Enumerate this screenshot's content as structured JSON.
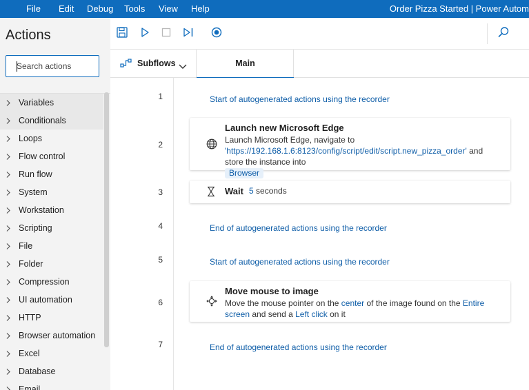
{
  "menu": {
    "items": [
      "File",
      "Edit",
      "Debug",
      "Tools",
      "View",
      "Help"
    ],
    "window_title": "Order Pizza Started | Power Autom"
  },
  "actions_pane": {
    "title": "Actions",
    "search_placeholder": "Search actions",
    "categories": [
      "Variables",
      "Conditionals",
      "Loops",
      "Flow control",
      "Run flow",
      "System",
      "Workstation",
      "Scripting",
      "File",
      "Folder",
      "Compression",
      "UI automation",
      "HTTP",
      "Browser automation",
      "Excel",
      "Database",
      "Email"
    ]
  },
  "toolbar": {
    "icons": [
      "save-icon",
      "run-icon",
      "stop-icon",
      "run-next-action-icon",
      "record-icon",
      "search-icon"
    ]
  },
  "tabs": {
    "subflows_label": "Subflows",
    "main_label": "Main"
  },
  "flow": {
    "steps": [
      {
        "num": "1",
        "type": "comment",
        "text": "Start of autogenerated actions using the recorder"
      },
      {
        "num": "2",
        "type": "action",
        "icon": "globe-icon",
        "title": "Launch new Microsoft Edge",
        "desc_prefix": "Launch Microsoft Edge, navigate to ",
        "url": "'https://192.168.1.6:8123/config/script/edit/script.new_pizza_order'",
        "desc_suffix": " and store the instance into",
        "variable": "Browser"
      },
      {
        "num": "3",
        "type": "action",
        "icon": "hourglass-icon",
        "title": "Wait",
        "value": "5",
        "unit": " seconds"
      },
      {
        "num": "4",
        "type": "comment",
        "text": "End of autogenerated actions using the recorder"
      },
      {
        "num": "5",
        "type": "comment",
        "text": "Start of autogenerated actions using the recorder"
      },
      {
        "num": "6",
        "type": "action",
        "icon": "move-mouse-icon",
        "title": "Move mouse to image",
        "p1": "Move the mouse pointer on the ",
        "k1": "center",
        "p2": " of the image found on the ",
        "k2": "Entire screen",
        "p3": " and send a ",
        "k3": "Left click",
        "p4": " on it"
      },
      {
        "num": "7",
        "type": "comment",
        "text": "End of autogenerated actions using the recorder"
      }
    ]
  }
}
